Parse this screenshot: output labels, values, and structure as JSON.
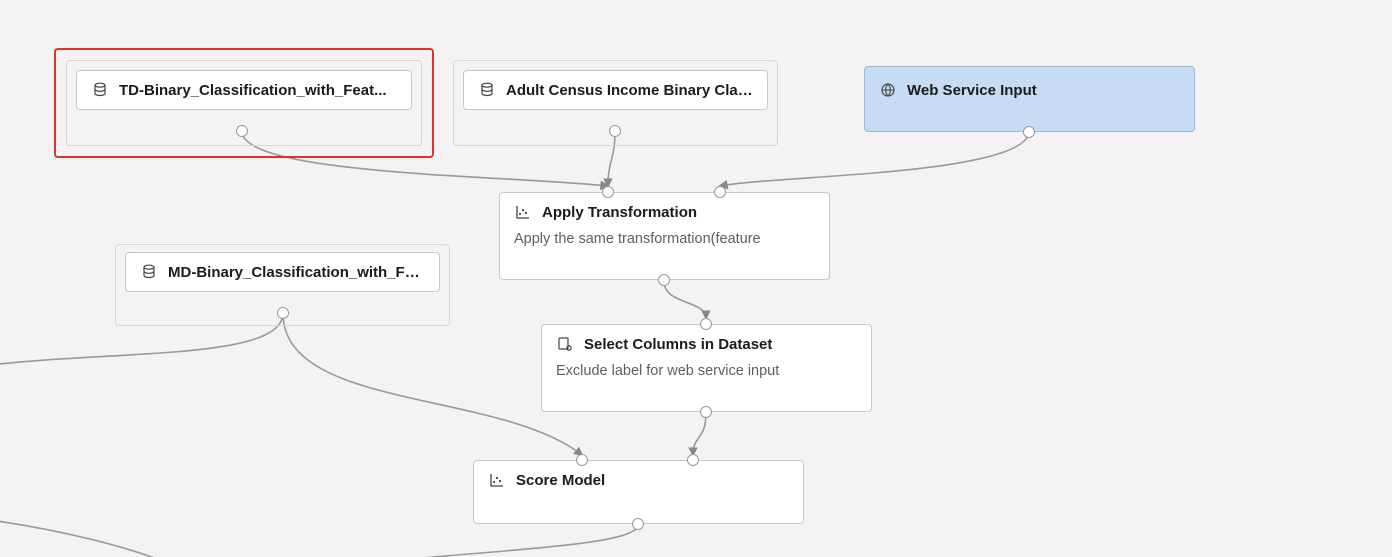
{
  "nodes": {
    "td_dataset": {
      "label": "TD-Binary_Classification_with_Feat...",
      "icon": "database"
    },
    "adult_census": {
      "label": "Adult Census Income Binary Classi...",
      "icon": "database"
    },
    "web_service_input": {
      "label": "Web Service Input",
      "icon": "globe"
    },
    "md_dataset": {
      "label": "MD-Binary_Classification_with_Fea...",
      "icon": "database"
    },
    "apply_transformation": {
      "label": "Apply Transformation",
      "subtitle": "Apply the same transformation(feature",
      "icon": "scatter"
    },
    "select_columns": {
      "label": "Select Columns in Dataset",
      "subtitle": "Exclude label for web service input",
      "icon": "dataset-gear"
    },
    "score_model": {
      "label": "Score Model",
      "icon": "scatter"
    }
  }
}
